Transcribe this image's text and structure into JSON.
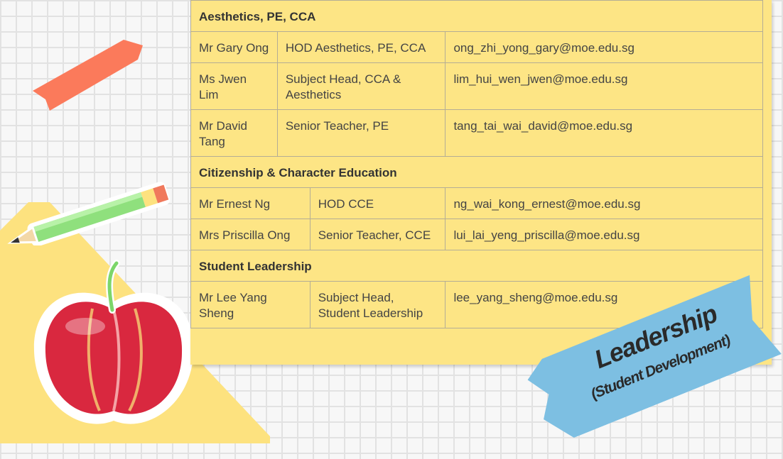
{
  "sections": [
    {
      "title": "Aesthetics, PE, CCA",
      "rows": [
        {
          "name": "Mr Gary Ong",
          "role": "HOD Aesthetics, PE, CCA",
          "email": "ong_zhi_yong_gary@moe.edu.sg"
        },
        {
          "name": "Ms Jwen Lim",
          "role": "Subject Head, CCA & Aesthetics",
          "email": "lim_hui_wen_jwen@moe.edu.sg"
        },
        {
          "name": "Mr David Tang",
          "role": "Senior Teacher, PE",
          "email": "tang_tai_wai_david@moe.edu.sg"
        }
      ]
    },
    {
      "title": "Citizenship & Character Education",
      "rows": [
        {
          "name": "Mr Ernest Ng",
          "role": "HOD CCE",
          "email": "ng_wai_kong_ernest@moe.edu.sg"
        },
        {
          "name": "Mrs Priscilla Ong",
          "role": "Senior Teacher, CCE",
          "email": "lui_lai_yeng_priscilla@moe.edu.sg"
        }
      ]
    },
    {
      "title": "Student Leadership",
      "rows": [
        {
          "name": "Mr Lee Yang Sheng",
          "role": "Subject Head, Student Leadership",
          "email": "lee_yang_sheng@moe.edu.sg"
        }
      ]
    }
  ],
  "tag": {
    "title": "Leadership",
    "subtitle": "(Student Development)"
  },
  "colors": {
    "sheet": "#fde585",
    "tag": "#7dbfe2",
    "ribbon": "#fb7a5b",
    "apple": "#d9283f"
  }
}
